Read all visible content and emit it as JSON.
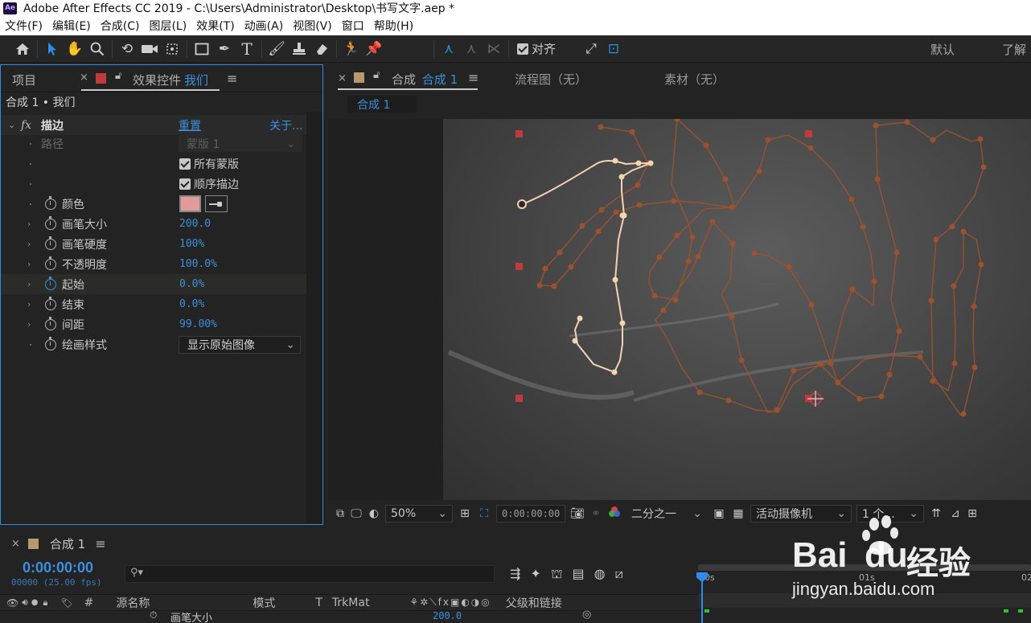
{
  "titlebar": {
    "app_icon_text": "Ae",
    "title": "Adobe After Effects CC 2019 - C:\\Users\\Administrator\\Desktop\\书写文字.aep *"
  },
  "menu": [
    "文件(F)",
    "编辑(E)",
    "合成(C)",
    "图层(L)",
    "效果(T)",
    "动画(A)",
    "视图(V)",
    "窗口",
    "帮助(H)"
  ],
  "toolbar": {
    "align_label": "对齐",
    "workspace_default": "默认",
    "workspace_learn": "了解"
  },
  "left_panel": {
    "tab_project": "项目",
    "tab_effects_prefix": "效果控件",
    "tab_effects_layer": "我们",
    "breadcrumb": "合成 1 • 我们",
    "effect_name": "描边",
    "reset_label": "重置",
    "about_label": "关于...",
    "path_label": "路径",
    "path_value": "蒙版 1",
    "all_masks_label": "所有蒙版",
    "sequential_label": "顺序描边",
    "color_label": "颜色",
    "brush_size_label": "画笔大小",
    "brush_size_value": "200.0",
    "brush_hardness_label": "画笔硬度",
    "brush_hardness_value": "100%",
    "opacity_label": "不透明度",
    "opacity_value": "100.0%",
    "start_label": "起始",
    "start_value": "0.0%",
    "end_label": "结束",
    "end_value": "0.0%",
    "spacing_label": "间距",
    "spacing_value": "99.00%",
    "paint_style_label": "绘画样式",
    "paint_style_value": "显示原始图像"
  },
  "viewer": {
    "tab_comp_prefix": "合成",
    "tab_comp_name": "合成 1",
    "tab_flowchart": "流程图（无）",
    "tab_footage": "素材（无）",
    "subtab": "合成 1",
    "zoom": "50%",
    "timecode": "0:00:00:00",
    "resolution": "二分之一",
    "camera": "活动摄像机",
    "views": "1 个..."
  },
  "timeline": {
    "tab": "合成 1",
    "time": "0:00:00:00",
    "fps": "00000 (25.00 fps)",
    "search_placeholder": "",
    "col_hash": "#",
    "col_source": "源名称",
    "col_mode": "模式",
    "col_t": "T",
    "col_trkmat": "TrkMat",
    "col_parent": "父级和链接",
    "row_label": "画笔大小",
    "row_value": "200.0",
    "ruler_0": "0s",
    "ruler_1": "01s",
    "ruler_2": "02"
  },
  "watermark": {
    "text_top": "Bai",
    "text_du": "du",
    "text_cn": "经验",
    "url": "jingyan.baidu.com"
  },
  "colors": {
    "accent_blue": "#2d8ceb",
    "value_blue": "#3b8fde",
    "stroke_color_swatch": "#e39a9a",
    "path_brown": "#a0522d",
    "path_light": "#f3d3b0",
    "handle_red": "#c0393b"
  }
}
